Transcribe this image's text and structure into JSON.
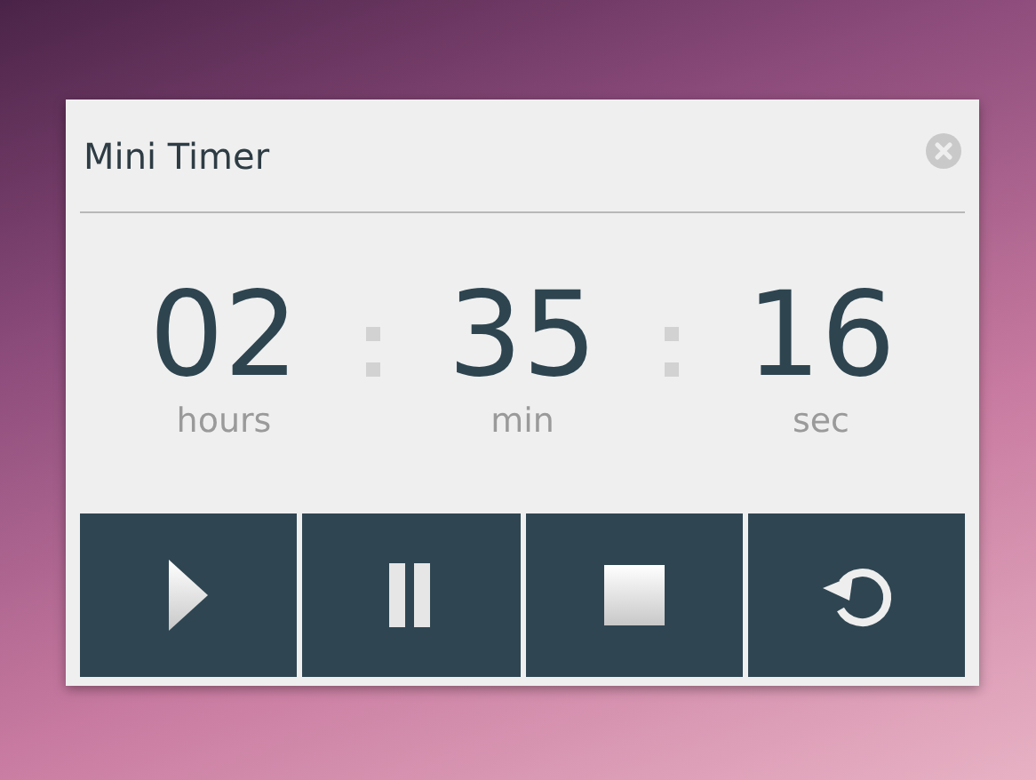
{
  "window": {
    "title": "Mini Timer"
  },
  "time": [
    {
      "value": "02",
      "unit": "hours"
    },
    {
      "value": "35",
      "unit": "min"
    },
    {
      "value": "16",
      "unit": "sec"
    }
  ],
  "controls": [
    {
      "kind": "play"
    },
    {
      "kind": "pause"
    },
    {
      "kind": "stop"
    },
    {
      "kind": "reset"
    }
  ]
}
